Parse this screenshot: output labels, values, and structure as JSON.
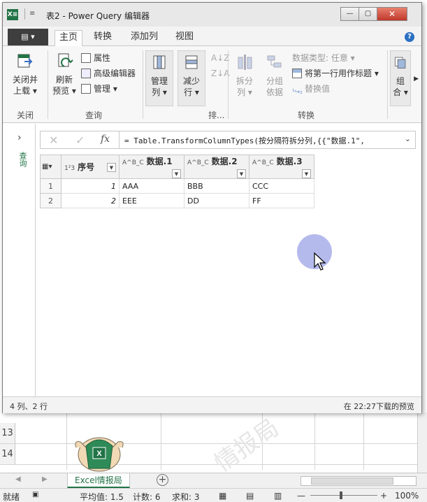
{
  "window": {
    "app_icon": "X≡",
    "qat": "≡",
    "title": "表2 - Power Query 编辑器",
    "buttons": [
      "—",
      "▢",
      "✕"
    ]
  },
  "tabs": {
    "file_label": "▤ ▾",
    "items": [
      "主页",
      "转换",
      "添加列",
      "视图"
    ],
    "active": "主页",
    "help": "?"
  },
  "ribbon": {
    "close_load": "关闭并\n上载",
    "close_load_l1": "关闭并",
    "close_load_l2": "上载 ▾",
    "group_close": "关闭",
    "refresh_l1": "刷新",
    "refresh_l2": "预览 ▾",
    "properties": "属性",
    "advanced_editor": "高级编辑器",
    "manage": "管理 ▾",
    "group_query": "查询",
    "manage_cols_l1": "管理",
    "manage_cols_l2": "列 ▾",
    "reduce_rows_l1": "减少",
    "reduce_rows_l2": "行 ▾",
    "group_sort": "排...",
    "split_l1": "拆分",
    "split_l2": "列 ▾",
    "groupby_l1": "分组",
    "groupby_l2": "依据",
    "data_type": "数据类型: 任意 ▾",
    "first_row_header": "将第一行用作标题 ▾",
    "replace_values": "替换值",
    "group_transform": "转换",
    "combine_l1": "组",
    "combine_l2": "合 ▾"
  },
  "query_pane": {
    "expand_glyph": "›",
    "label": "查询"
  },
  "formula_bar": {
    "cancel": "✕",
    "confirm": "✓",
    "fx": "fx",
    "formula": "= Table.TransformColumnTypes(按分隔符拆分列,{{\"数据.1\",",
    "expand": "⌄"
  },
  "grid": {
    "corner": "▦▾",
    "columns": [
      {
        "type": "1²3",
        "name": "序号"
      },
      {
        "type": "A^B_C",
        "name": "数据.1"
      },
      {
        "type": "A^B_C",
        "name": "数据.2"
      },
      {
        "type": "A^B_C",
        "name": "数据.3"
      }
    ],
    "rows": [
      {
        "n": "1",
        "c0": "1",
        "c1": "AAA",
        "c2": "BBB",
        "c3": "CCC"
      },
      {
        "n": "2",
        "c0": "2",
        "c1": "EEE",
        "c2": "DD",
        "c3": "FF"
      }
    ]
  },
  "pq_status": {
    "left": "4 列、2 行",
    "right": "在 22:27下载的预览"
  },
  "excel": {
    "row_13": "13",
    "row_14": "14",
    "watermark": "情报局",
    "sheet_tab": "Excel情报局",
    "add_sheet": "+",
    "status_ready": "就绪",
    "average": "平均值: 1.5",
    "count": "计数: 6",
    "sum": "求和: 3",
    "zoom": "100%",
    "zoom_minus": "—",
    "zoom_plus": "+"
  },
  "colors": {
    "excel_green": "#217346",
    "cursor_highlight": "#7882dc"
  }
}
